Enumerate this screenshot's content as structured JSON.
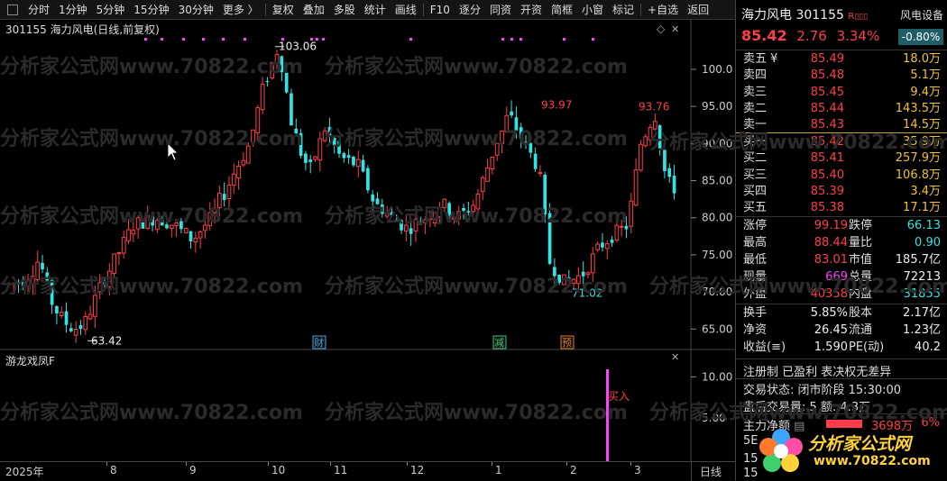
{
  "toolbar": {
    "items": [
      "分时",
      "1分钟",
      "5分钟",
      "15分钟",
      "30分钟",
      "更多 〉",
      "复权",
      "叠加",
      "多股",
      "统计",
      "画线",
      "F10",
      "逐分",
      "同资",
      "开资",
      "简框",
      "小窗",
      "标记",
      "+自选",
      "返回"
    ]
  },
  "chart": {
    "title": "301155 海力风电(日线,前复权)",
    "high_label": "103.06",
    "low_label": "63.42",
    "peak1_label": "93.97",
    "peak2_label": "93.76",
    "dip_label": "71.02",
    "y_ticks": [
      "100.0",
      "95.00",
      "90.00",
      "85.00",
      "80.00",
      "75.00",
      "70.00",
      "65.00"
    ],
    "y_range": [
      62,
      104
    ],
    "event_markers": [
      {
        "label": "财",
        "color": "#4aa0e0"
      },
      {
        "label": "减",
        "color": "#3fc46e"
      },
      {
        "label": "预",
        "color": "#e0782a"
      }
    ],
    "up_color": "#ff3d4a",
    "down_color": "#33e3e3"
  },
  "subchart": {
    "title": "游龙戏凤F",
    "y_ticks": [
      "10.00",
      "5.00"
    ],
    "signal_label": "买入",
    "signal_color": "#ff40ff"
  },
  "timeaxis": {
    "labels": [
      "2025年",
      "8",
      "9",
      "10",
      "11",
      "12",
      "1",
      "2",
      "3"
    ],
    "right_label": "日线"
  },
  "quote": {
    "name": "海力风电",
    "code": "301155",
    "badge": "R",
    "sector": "风电设备",
    "price": "85.42",
    "change": "2.76",
    "change_pct": "3.34%",
    "sector_pct": "-0.80%",
    "asks": [
      {
        "label": "卖五 ¥",
        "price": "85.49",
        "vol": "18.0万"
      },
      {
        "label": "卖四",
        "price": "85.48",
        "vol": "5.1万"
      },
      {
        "label": "卖三",
        "price": "85.45",
        "vol": "9.4万"
      },
      {
        "label": "卖二",
        "price": "85.44",
        "vol": "143.5万"
      },
      {
        "label": "卖一",
        "price": "85.43",
        "vol": "14.5万"
      }
    ],
    "bids": [
      {
        "label": "买一",
        "price": "85.42",
        "vol": "35.9万"
      },
      {
        "label": "买二",
        "price": "85.41",
        "vol": "257.9万"
      },
      {
        "label": "买三",
        "price": "85.40",
        "vol": "106.8万"
      },
      {
        "label": "买四",
        "price": "85.39",
        "vol": "3.4万"
      },
      {
        "label": "买五",
        "price": "85.38",
        "vol": "17.1万"
      }
    ],
    "stats": [
      {
        "l1": "涨停",
        "v1": "99.19",
        "c1": "red",
        "l2": "跌停",
        "v2": "66.13",
        "c2": "cyan"
      },
      {
        "l1": "最高",
        "v1": "88.44",
        "c1": "red",
        "l2": "量比",
        "v2": "0.90",
        "c2": "cyan"
      },
      {
        "l1": "最低",
        "v1": "83.01",
        "c1": "red",
        "l2": "市值",
        "v2": "185.7亿",
        "c2": "wht"
      },
      {
        "l1": "现量",
        "v1": "669",
        "c1": "mag",
        "l2": "总量",
        "v2": "72213",
        "c2": "wht"
      },
      {
        "l1": "外盘",
        "v1": "40358",
        "c1": "red",
        "l2": "内盘",
        "v2": "31855",
        "c2": "cyan"
      }
    ],
    "stats2": [
      {
        "l1": "换手",
        "v1": "5.85%",
        "l2": "股本",
        "v2": "2.17亿"
      },
      {
        "l1": "净资",
        "v1": "26.45",
        "l2": "流通",
        "v2": "1.23亿"
      },
      {
        "l1": "收益(≡)",
        "v1": "1.590",
        "l2": "PE(动)",
        "v2": "40.2"
      }
    ],
    "tags": "注册制 已盈利 表决权无差异",
    "trade_status": "交易状态: 闭市阶段 15:30:00",
    "after_hours": "盘后交易量: 5  额: 4.3万",
    "main_net_label": "主力净额",
    "main_net_value": "3698万",
    "main_net_pct": "6%",
    "row_5e": "5E",
    "row_15a": "15",
    "row_15b": "15"
  },
  "watermark": {
    "text": "分析家公式网www.70822.com",
    "logo_text": "分析家公式网",
    "logo_url": "www.70822.com"
  }
}
